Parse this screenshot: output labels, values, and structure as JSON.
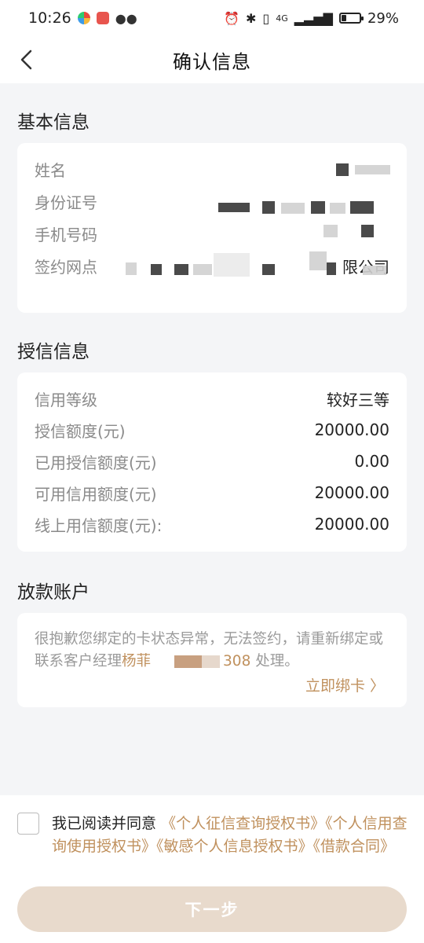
{
  "status_bar": {
    "time": "10:26",
    "network": "4G",
    "battery": "29%",
    "battery_fraction": 0.29
  },
  "nav": {
    "title": "确认信息",
    "back_icon": "chevron-left-icon"
  },
  "basic_info": {
    "section_title": "基本信息",
    "rows": [
      {
        "label": "姓名",
        "value": "",
        "value_masked": true
      },
      {
        "label": "身份证号",
        "value": "",
        "value_masked": true
      },
      {
        "label": "手机号码",
        "value": "",
        "value_masked": true
      },
      {
        "label": "签约网点",
        "value": "限公司",
        "value_masked": true
      }
    ]
  },
  "credit_info": {
    "section_title": "授信信息",
    "rows": [
      {
        "label": "信用等级",
        "value": "较好三等"
      },
      {
        "label": "授信额度(元)",
        "value": "20000.00"
      },
      {
        "label": "已用授信额度(元)",
        "value": "0.00"
      },
      {
        "label": "可用信用额度(元)",
        "value": "20000.00"
      },
      {
        "label": "线上用信额度(元):",
        "value": "20000.00"
      }
    ]
  },
  "payout_account": {
    "section_title": "放款账户",
    "notice_prefix": "很抱歉您绑定的卡状态异常，无法签约，请重新绑定或联系客户经理",
    "manager_name": "杨菲",
    "manager_phone_suffix": "308",
    "notice_suffix": " 处理。",
    "bind_link": "立即绑卡 〉"
  },
  "agreement": {
    "prefix": "我已阅读并同意",
    "docs": [
      "《个人征信查询授权书》",
      "《个人信用查询使用授权书》",
      "《敏感个人信息授权书》",
      "《借款合同》"
    ],
    "checked": false
  },
  "next_button": "下一步",
  "colors": {
    "accent": "#c0915e",
    "button_disabled": "#e8dacc",
    "background": "#f4f5f7"
  }
}
